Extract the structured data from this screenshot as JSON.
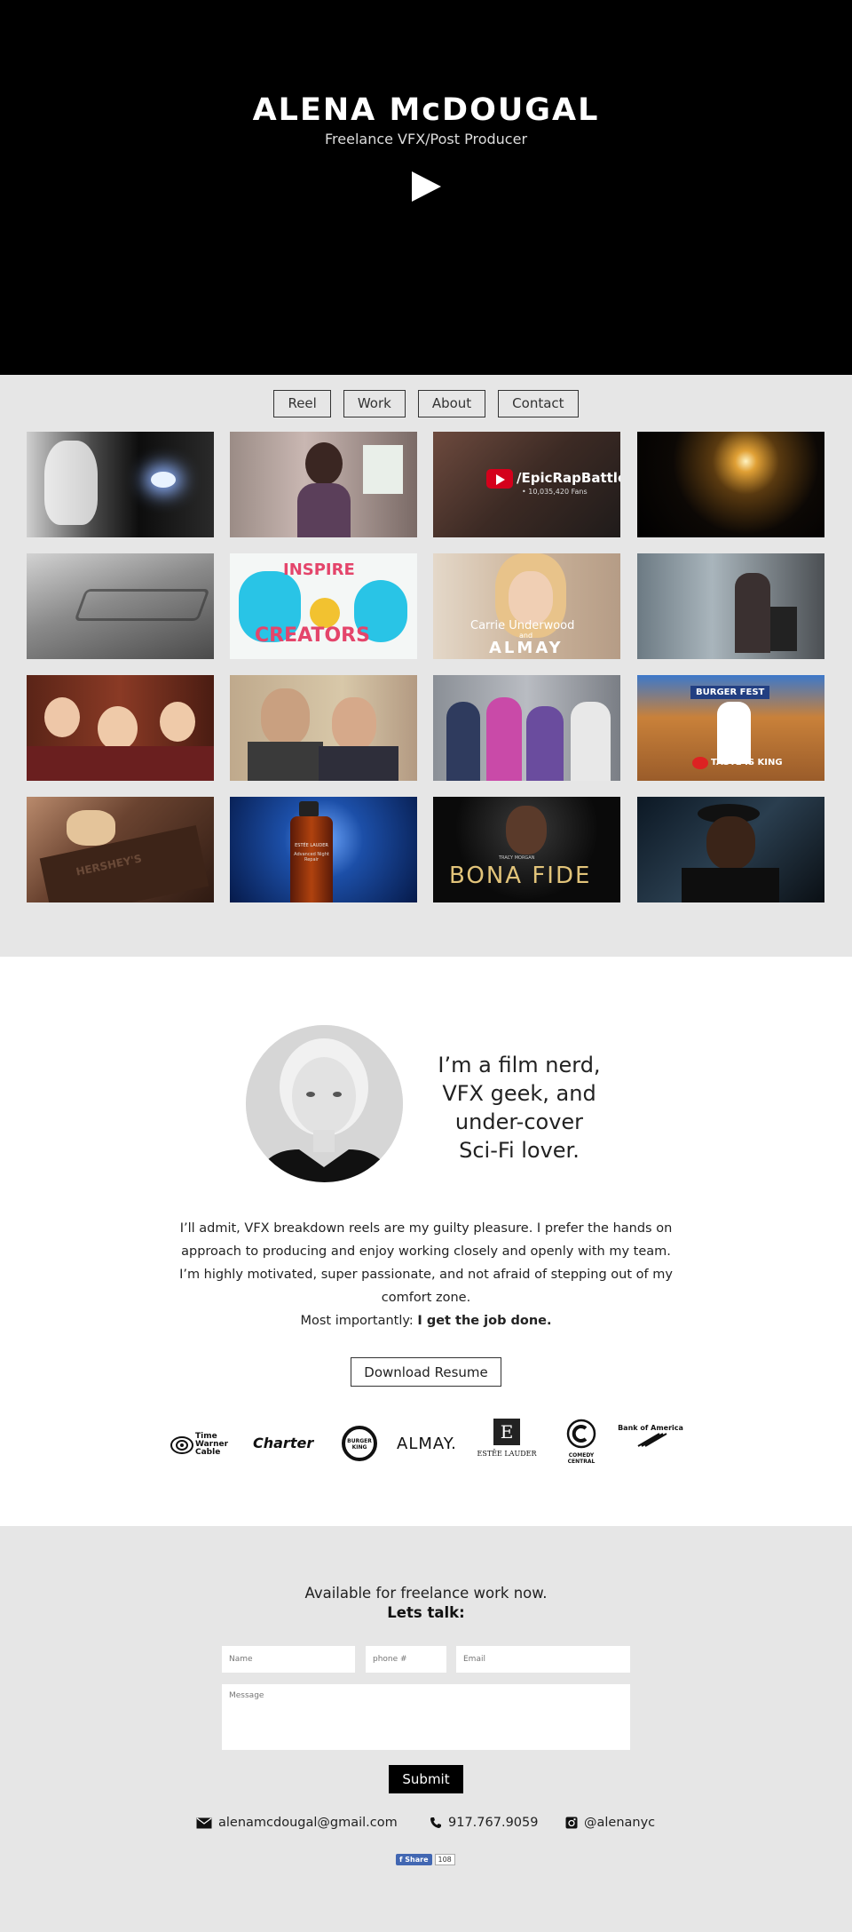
{
  "hero": {
    "title": "ALENA McDOUGAL",
    "subtitle": "Freelance VFX/Post Producer"
  },
  "nav": {
    "items": [
      "Reel",
      "Work",
      "About",
      "Contact"
    ]
  },
  "gallery": {
    "captions": {
      "epic_channel": "/EpicRapBattles",
      "epic_fans": "• 10,035,420 Fans",
      "inspire_line1": "INSPIRE",
      "inspire_line2": "CREATORS",
      "carrie": "Carrie Underwood",
      "and": "and",
      "almay": "ALMAY",
      "burgerfest": "BURGER FEST",
      "taste": "TASTE IS KING",
      "hersheys": "HERSHEY'S",
      "estee_brand": "ESTÉE LAUDER",
      "estee_product": "Advanced Night Repair",
      "tracy": "TRACY MORGAN",
      "bonafide": "BONA FIDE"
    }
  },
  "about": {
    "tagline": [
      "I’m a film nerd,",
      "VFX geek, and",
      "under-cover",
      "Sci-Fi lover."
    ],
    "bio": "I’ll admit, VFX breakdown reels are my guilty pleasure. I prefer the hands on approach to producing and enjoy working closely and openly with my team. I’m highly motivated, super passionate, and not afraid of stepping out of my comfort zone.",
    "bio_prefix": "Most importantly: ",
    "bio_bold": "I get the job done.",
    "resume_label": "Download Resume",
    "logos": {
      "twc": "Time Warner Cable",
      "charter": "Charter",
      "bk": "BURGER KING",
      "almay": "ALMAY.",
      "estee": "ESTĒE LAUDER",
      "comedy": "COMEDY CENTRAL",
      "boa": "Bank of America"
    }
  },
  "contact": {
    "available": "Available for freelance work now.",
    "talk": "Lets talk:",
    "name_placeholder": "Name",
    "phone_placeholder": "phone #",
    "email_placeholder": "Email",
    "message_placeholder": "Message",
    "submit_label": "Submit",
    "email": "alenamcdougal@gmail.com",
    "phone": "917.767.9059",
    "instagram": "@alenanyc",
    "share_label": "Share",
    "share_count": "108"
  }
}
